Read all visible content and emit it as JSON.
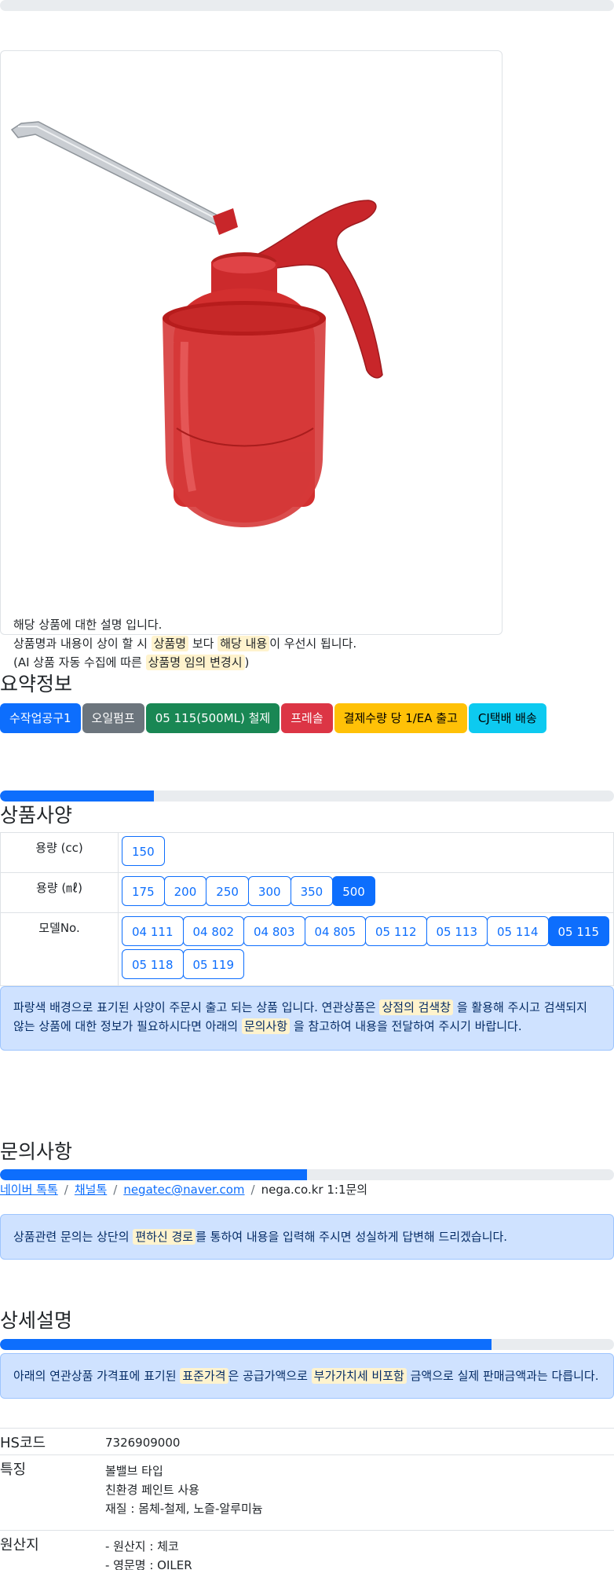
{
  "colors": {
    "primary": "#0d6efd",
    "secondary": "#6c757d",
    "success": "#198754",
    "danger": "#dc3545",
    "warning": "#ffc107",
    "info": "#0dcaf0"
  },
  "product": {
    "image_alt": "red oil can",
    "desc_line1": "해당 상품에 대한 설명 입니다.",
    "desc_line2_a": "상품명과 내용이 상이 할 시",
    "desc_line2_hl1": "상품명",
    "desc_line2_b": "보다",
    "desc_line2_hl2": "해당 내용",
    "desc_line2_c": "이 우선시 됩니다.",
    "desc_line3_a": "(AI 상품 자동 수집에 따른",
    "desc_line3_hl": "상품명 임의 변경시",
    "desc_line3_b": ")"
  },
  "summary": {
    "title": "요약정보",
    "badges": [
      {
        "label": "수작업공구1",
        "color": "primary"
      },
      {
        "label": "오일펌프",
        "color": "secondary"
      },
      {
        "label": "05 115(500ML) 철제",
        "color": "success"
      },
      {
        "label": "프레솔",
        "color": "danger"
      },
      {
        "label": "결제수량 당 1/EA 출고",
        "color": "warning"
      },
      {
        "label": "CJ택배 배송",
        "color": "info"
      }
    ]
  },
  "progress": {
    "spec": 0.25,
    "inquiry": 0.5,
    "detail": 0.8
  },
  "spec": {
    "title": "상품사양",
    "rows": [
      {
        "label": "용량 (cc)",
        "options": [
          "150"
        ],
        "selected": null
      },
      {
        "label": "용량 (㎖)",
        "options": [
          "175",
          "200",
          "250",
          "300",
          "350",
          "500"
        ],
        "selected": "500"
      },
      {
        "label": "모델No.",
        "options": [
          "04 111",
          "04 802",
          "04 803",
          "04 805",
          "05 112",
          "05 113",
          "05 114",
          "05 115",
          "05 118",
          "05 119"
        ],
        "selected": "05 115"
      }
    ],
    "notice_a": "파랑색 배경으로 표기된 사양이 주문시 출고 되는 상품 입니다. 연관상품은",
    "notice_hl1": "상점의 검색창",
    "notice_b": "을 활용해 주시고 검색되지 않는 상품에 대한 정보가 필요하시다면 아래의",
    "notice_hl2": "문의사항",
    "notice_c": "을 참고하여 내용을 전달하여 주시기 바랍니다."
  },
  "inquiry": {
    "title": "문의사항",
    "link1": "네이버 톡톡",
    "link2": "채널톡",
    "link3": "negatec@naver.com",
    "text4": "nega.co.kr 1:1문의",
    "sep": "/",
    "notice_a": "상품관련 문의는 상단의",
    "notice_hl": "편하신 경로",
    "notice_b": "를 통하여 내용을 입력해 주시면 성실하게 답변해 드리겠습니다."
  },
  "detail": {
    "title": "상세설명",
    "notice_a": "아래의 연관상품 가격표에 표기된",
    "notice_hl1": "표준가격",
    "notice_b": "은 공급가액으로",
    "notice_hl2": "부가가치세 비포함",
    "notice_c": "금액으로 실제 판매금액과는 다릅니다.",
    "hs_label": "HS코드",
    "hs_value": "7326909000",
    "feature_label": "특징",
    "features": [
      "볼밸브 타입",
      "친환경 페인트 사용",
      "재질 : 몸체-철제, 노즐-알루미늄"
    ],
    "origin_label": "원산지",
    "origins": [
      "- 원산지 : 체코",
      "- 영문명 : OILER"
    ]
  }
}
